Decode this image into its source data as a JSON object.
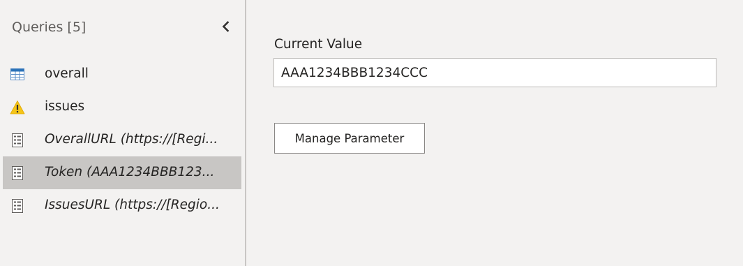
{
  "sidebar": {
    "header": "Queries [5]",
    "collapse_icon": "chevron-left-icon",
    "items": [
      {
        "label": "overall",
        "icon": "table-icon",
        "italic": false,
        "selected": false
      },
      {
        "label": "issues",
        "icon": "warning-icon",
        "italic": false,
        "selected": false
      },
      {
        "label": "OverallURL (https://[Regi...",
        "icon": "parameter-icon",
        "italic": true,
        "selected": false
      },
      {
        "label": "Token (AAA1234BBB123...",
        "icon": "parameter-icon",
        "italic": true,
        "selected": true
      },
      {
        "label": "IssuesURL (https://[Regio...",
        "icon": "parameter-icon",
        "italic": true,
        "selected": false
      }
    ]
  },
  "main": {
    "current_value_label": "Current Value",
    "current_value": "AAA1234BBB1234CCC",
    "manage_button_label": "Manage Parameter"
  },
  "colors": {
    "background": "#f3f2f1",
    "selected_row": "#c8c6c4",
    "table_icon": "#2b72b8",
    "warning_icon": "#f5c518",
    "text": "#252423"
  }
}
